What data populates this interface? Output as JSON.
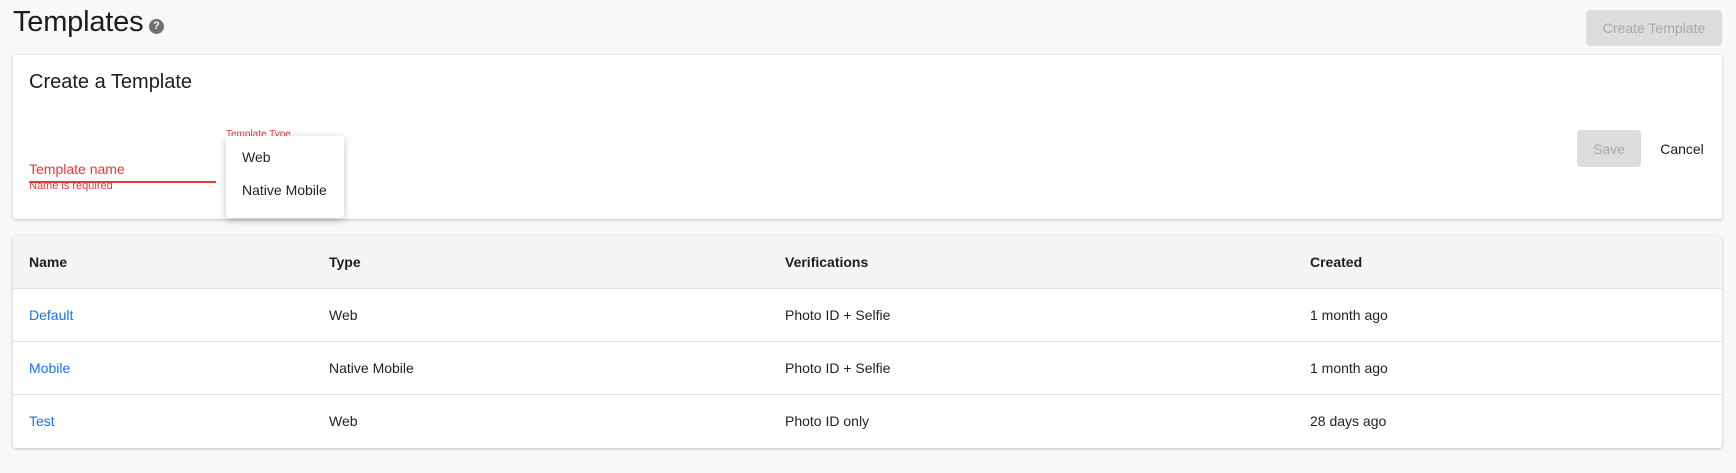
{
  "header": {
    "title": "Templates",
    "help_icon": "?",
    "create_button": "Create Template"
  },
  "create_form": {
    "title": "Create a Template",
    "name_placeholder": "Template name",
    "name_error": "Name is required",
    "type_label": "Template Type",
    "type_options": [
      "Web",
      "Native Mobile"
    ],
    "save_label": "Save",
    "cancel_label": "Cancel"
  },
  "table": {
    "columns": [
      "Name",
      "Type",
      "Verifications",
      "Created"
    ],
    "rows": [
      {
        "name": "Default",
        "type": "Web",
        "verifications": "Photo ID + Selfie",
        "created": "1 month ago"
      },
      {
        "name": "Mobile",
        "type": "Native Mobile",
        "verifications": "Photo ID + Selfie",
        "created": "1 month ago"
      },
      {
        "name": "Test",
        "type": "Web",
        "verifications": "Photo ID only",
        "created": "28 days ago"
      }
    ]
  },
  "colors": {
    "error": "#e53935",
    "link": "#1a73e8",
    "disabled_bg": "#dcdcdc"
  }
}
